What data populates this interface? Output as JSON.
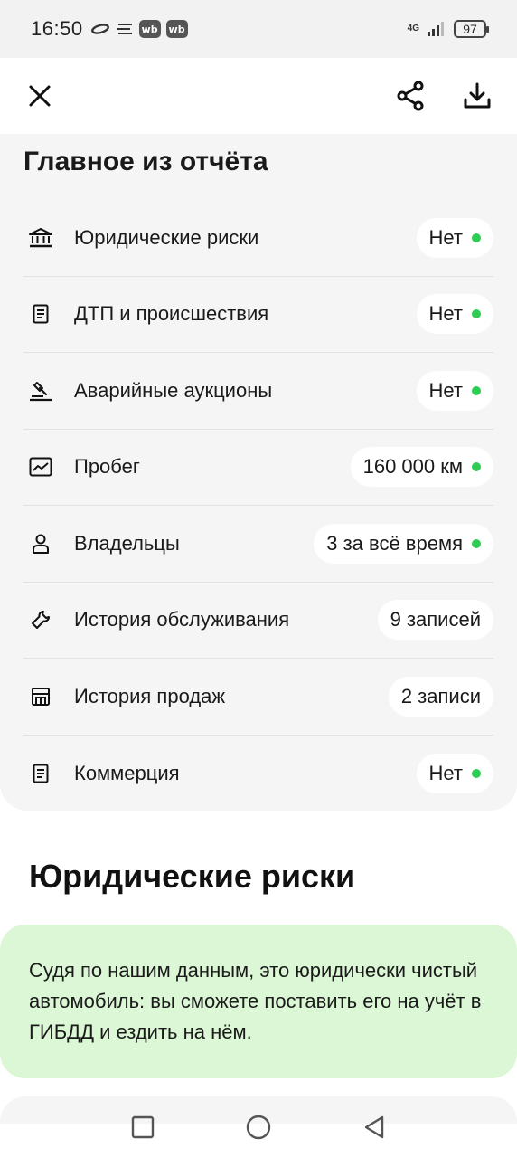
{
  "status_bar": {
    "time": "16:50",
    "badge1": "wb",
    "badge2": "wb",
    "network": "4G",
    "battery": "97"
  },
  "toolbar": {
    "close_icon": "close-icon",
    "share_icon": "share-icon",
    "download_icon": "download-icon"
  },
  "summary": {
    "title": "Главное из отчёта",
    "rows": [
      {
        "icon": "bank-icon",
        "label": "Юридические риски",
        "value": "Нет",
        "dot": true
      },
      {
        "icon": "document-icon",
        "label": "ДТП и происшествия",
        "value": "Нет",
        "dot": true
      },
      {
        "icon": "gavel-icon",
        "label": "Аварийные аукционы",
        "value": "Нет",
        "dot": true
      },
      {
        "icon": "chart-icon",
        "label": "Пробег",
        "value": "160 000 км",
        "dot": true
      },
      {
        "icon": "person-icon",
        "label": "Владельцы",
        "value": "3 за всё время",
        "dot": true
      },
      {
        "icon": "wrench-icon",
        "label": "История обслуживания",
        "value": "9 записей",
        "dot": false
      },
      {
        "icon": "store-icon",
        "label": "История продаж",
        "value": "2 записи",
        "dot": false
      },
      {
        "icon": "document-icon",
        "label": "Коммерция",
        "value": "Нет",
        "dot": true
      }
    ]
  },
  "legal": {
    "heading": "Юридические риски",
    "text": "Судя по нашим данным, это юридически чистый автомобиль: вы сможете поставить его на учёт в ГИБДД и ездить на нём."
  },
  "colors": {
    "ok_dot": "#2ecc52",
    "legal_card_bg": "#dcf7d6",
    "card_bg": "#f5f5f5"
  },
  "nav": {
    "recent_icon": "square-icon",
    "home_icon": "circle-icon",
    "back_icon": "triangle-back-icon"
  }
}
